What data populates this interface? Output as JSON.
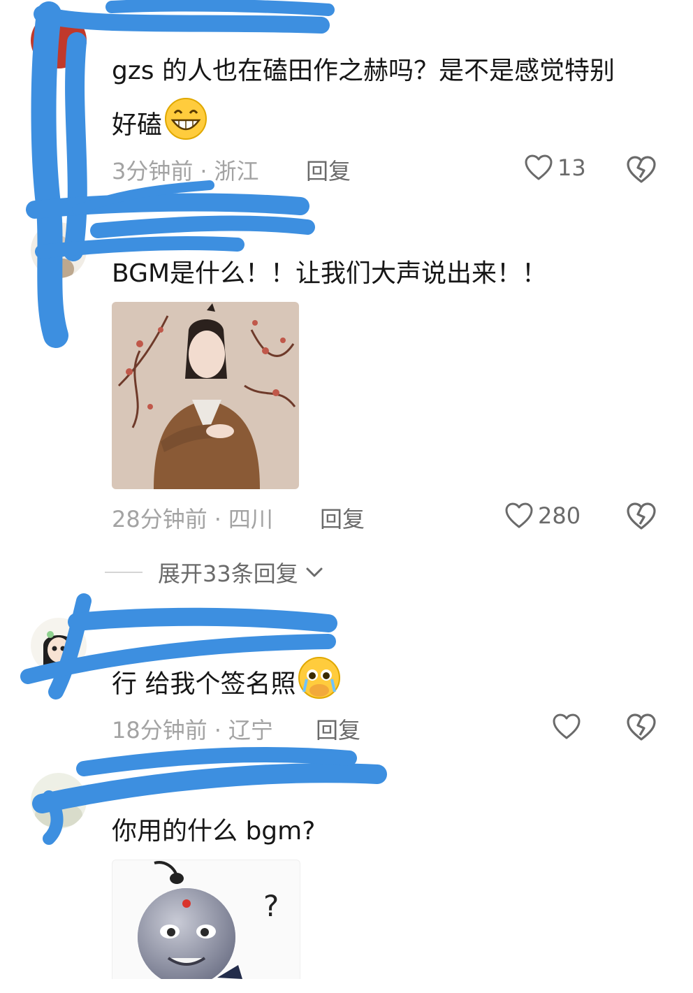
{
  "comments": [
    {
      "text_line1": "gzs 的人也在磕田作之赫吗？是不是感觉特别",
      "text_line2": "好磕",
      "time": "3分钟前",
      "location": "浙江",
      "reply_label": "回复",
      "likes": "13"
    },
    {
      "text": "BGM是什么！！让我们大声说出来！！",
      "time": "28分钟前",
      "location": "四川",
      "reply_label": "回复",
      "likes": "280",
      "expand_label": "展开33条回复"
    },
    {
      "text": "行 给我个签名照",
      "time": "18分钟前",
      "location": "辽宁",
      "reply_label": "回复",
      "likes": ""
    },
    {
      "text": "你用的什么 bgm?",
      "sticker_mark": "?"
    }
  ],
  "separator": "·",
  "colors": {
    "redact": "#3d8fe0",
    "muted": "#a3a3a3",
    "icon": "#6a6a6a"
  }
}
